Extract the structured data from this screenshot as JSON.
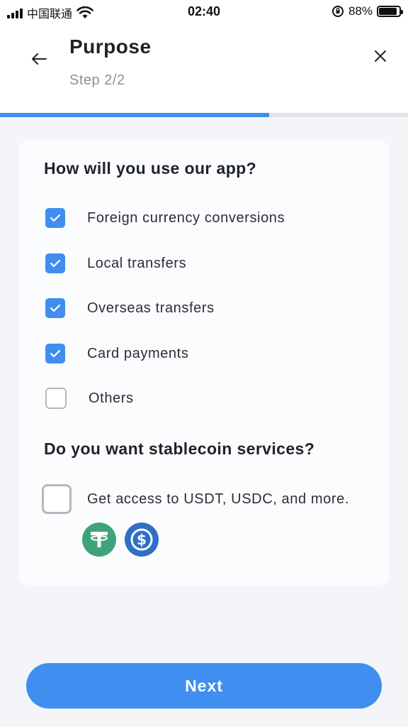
{
  "status_bar": {
    "carrier": "中国联通",
    "time": "02:40",
    "battery_text": "88%",
    "battery_level": 0.88,
    "icons": [
      "signal-icon",
      "wifi-icon",
      "orientation-lock-icon",
      "battery-icon"
    ]
  },
  "header": {
    "title": "Purpose",
    "step": "Step 2/2",
    "back_icon": "arrow-left-icon",
    "close_icon": "close-icon"
  },
  "progress": {
    "value": 0.66
  },
  "usage": {
    "question": "How will you use our app?",
    "options": [
      {
        "label": "Foreign currency conversions",
        "checked": true
      },
      {
        "label": "Local transfers",
        "checked": true
      },
      {
        "label": "Overseas transfers",
        "checked": true
      },
      {
        "label": "Card payments",
        "checked": true
      },
      {
        "label": "Others",
        "checked": false
      }
    ]
  },
  "stablecoin": {
    "question": "Do you want stablecoin services?",
    "option_label": "Get access to USDT, USDC, and more.",
    "checked": false,
    "coin_icons": [
      "tether-usdt-icon",
      "usdc-icon"
    ]
  },
  "colors": {
    "accent": "#3f8ef0",
    "usdt": "#3fa37a",
    "usdc": "#2f6fc7"
  },
  "footer": {
    "next_label": "Next"
  }
}
